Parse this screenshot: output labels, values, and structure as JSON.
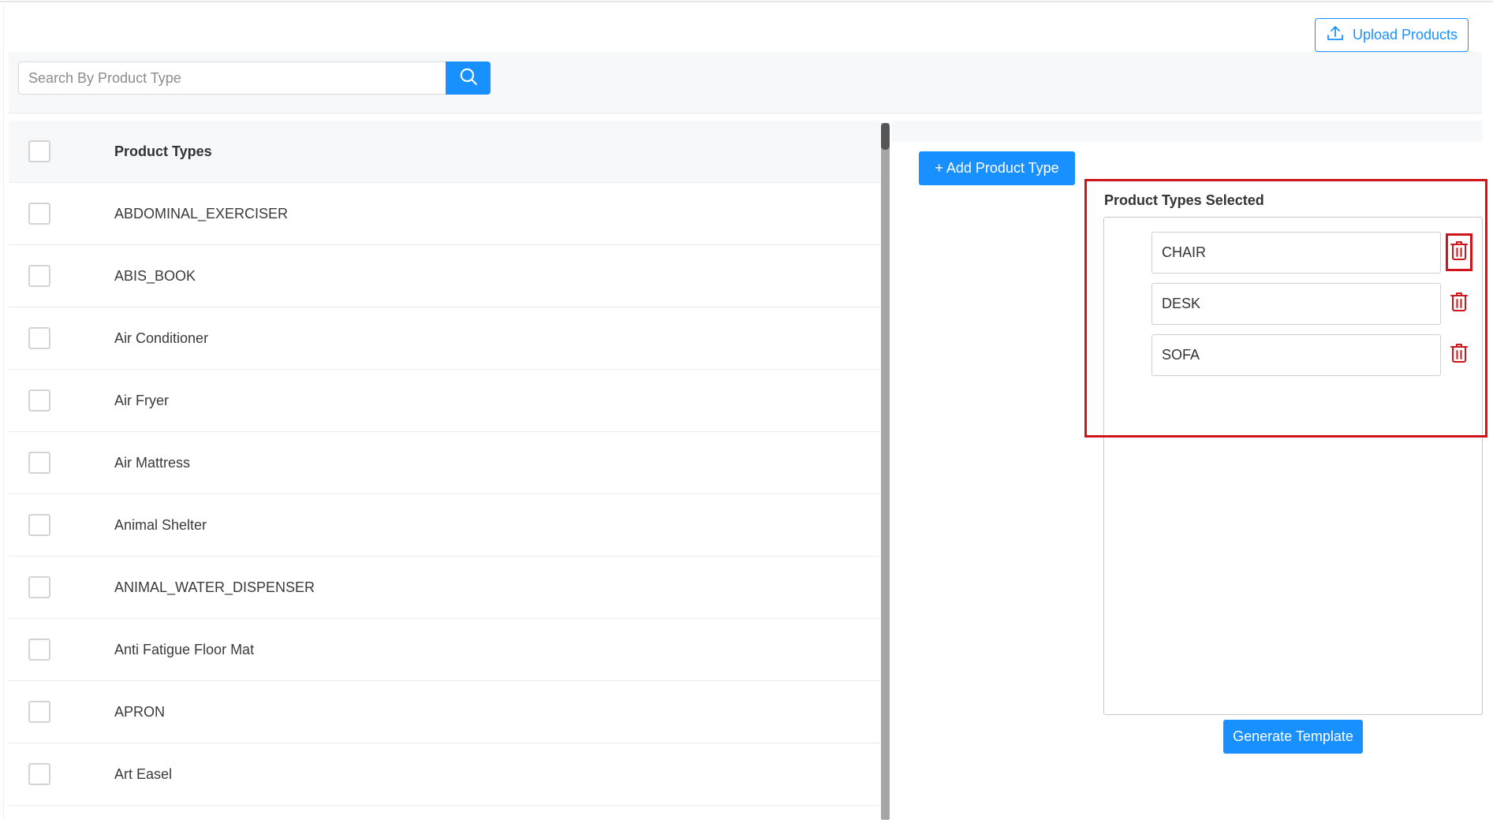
{
  "header": {
    "upload_label": "Upload Products",
    "upload_icon": "upload-icon"
  },
  "search": {
    "placeholder": "Search By Product Type",
    "value": "",
    "button_icon": "search-icon"
  },
  "table": {
    "header_label": "Product Types",
    "rows": [
      "ABDOMINAL_EXERCISER",
      "ABIS_BOOK",
      "Air Conditioner",
      "Air Fryer",
      "Air Mattress",
      "Animal Shelter",
      "ANIMAL_WATER_DISPENSER",
      "Anti Fatigue Floor Mat",
      "APRON",
      "Art Easel"
    ]
  },
  "right_panel": {
    "add_label": "+ Add Product Type",
    "selected_title": "Product Types Selected",
    "selected_items": [
      "CHAIR",
      "DESK",
      "SOFA"
    ],
    "delete_icon": "trash-icon",
    "generate_label": "Generate Template"
  },
  "colors": {
    "primary": "#1890ff",
    "danger": "#d0151a",
    "header_bg": "#f7f8fa"
  }
}
